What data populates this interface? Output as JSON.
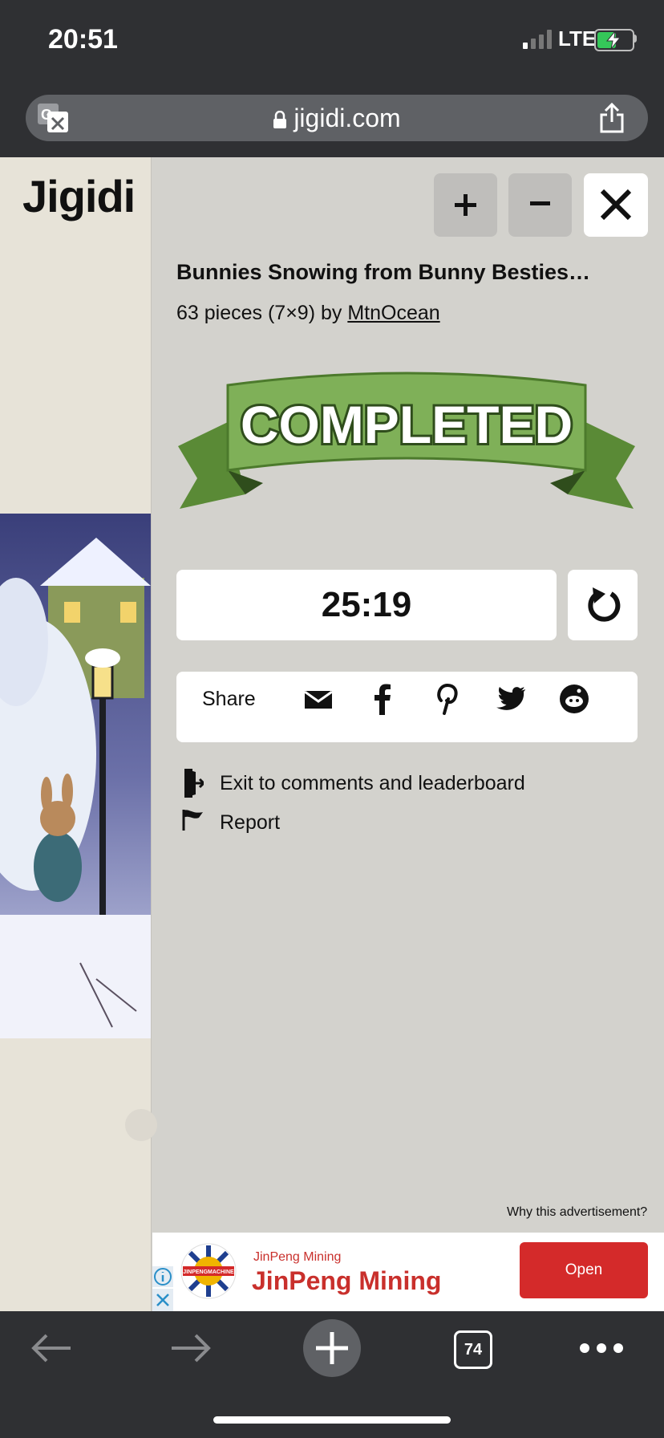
{
  "status_bar": {
    "time": "20:51",
    "network": "LTE"
  },
  "url_bar": {
    "domain": "jigidi.com"
  },
  "site": {
    "logo": "Jigidi"
  },
  "controls": {
    "zoom_in": "+",
    "zoom_out": "−",
    "close": "✕"
  },
  "puzzle": {
    "title": "Bunnies Snowing from Bunny Besties…",
    "meta_prefix": "63 pieces (7×9) by ",
    "author": "MtnOcean",
    "status_banner": "COMPLETED",
    "time": "25:19"
  },
  "share": {
    "label": "Share",
    "icons": [
      "email-icon",
      "facebook-icon",
      "pinterest-icon",
      "twitter-icon",
      "reddit-icon"
    ]
  },
  "links": {
    "exit": "Exit to comments and leaderboard",
    "report": "Report"
  },
  "ad": {
    "why": "Why this advertisement?",
    "sponsor_small": "JinPeng Mining",
    "sponsor_big": "JinPeng Mining",
    "logo_text": "JINPENGMACHINE",
    "cta": "Open"
  },
  "toolbar": {
    "tab_count": "74"
  },
  "colors": {
    "chrome_bg": "#2f3033",
    "page_bg": "#d3d2cd",
    "banner_green": "#6fa04a",
    "ad_red": "#d42a2a"
  },
  "battery_level": 0.55
}
